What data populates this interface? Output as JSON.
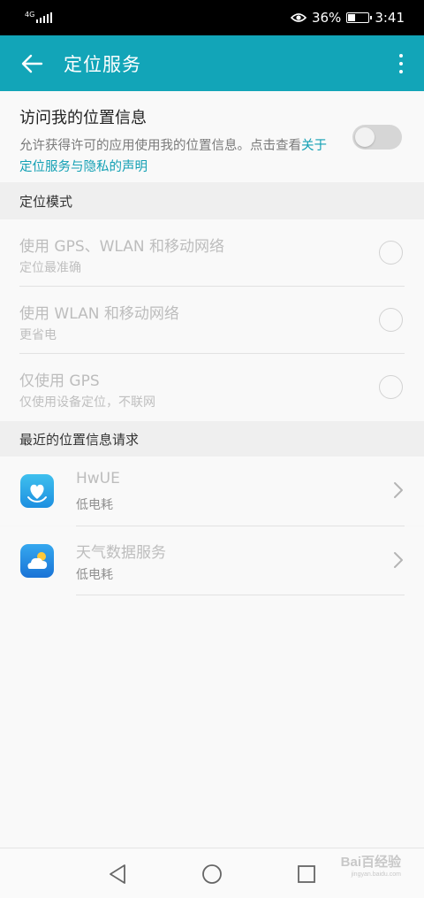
{
  "status_bar": {
    "network": "4G",
    "battery": "36%",
    "battery_level": 0.36,
    "time": "3:41",
    "icons": [
      "signal-icon",
      "eye-comfort-icon",
      "battery-icon"
    ]
  },
  "app_bar": {
    "title": "定位服务",
    "back_icon": "arrow-left-icon",
    "more_icon": "more-vertical-icon"
  },
  "location_access": {
    "title": "访问我的位置信息",
    "description": "允许获得许可的应用使用我的位置信息。点击查看",
    "link": "关于定位服务与隐私的声明",
    "enabled": false
  },
  "mode_section": {
    "header": "定位模式",
    "options": [
      {
        "title": "使用 GPS、WLAN 和移动网络",
        "subtitle": "定位最准确",
        "selected": false
      },
      {
        "title": "使用 WLAN 和移动网络",
        "subtitle": "更省电",
        "selected": false
      },
      {
        "title": "仅使用 GPS",
        "subtitle": "仅使用设备定位，不联网",
        "selected": false
      }
    ]
  },
  "recent_section": {
    "header": "最近的位置信息请求",
    "apps": [
      {
        "name": "HwUE",
        "usage": "低电耗",
        "icon": "hwue-app-icon"
      },
      {
        "name": "天气数据服务",
        "usage": "低电耗",
        "icon": "weather-app-icon"
      }
    ]
  },
  "nav_bar": {
    "icons": [
      "back-triangle-icon",
      "home-circle-icon",
      "recents-square-icon"
    ]
  },
  "watermark": {
    "text": "Bai百经验",
    "url": "jingyan.baidu.com"
  },
  "colors": {
    "accent": "#12a5b8",
    "link": "#12a0b4"
  }
}
